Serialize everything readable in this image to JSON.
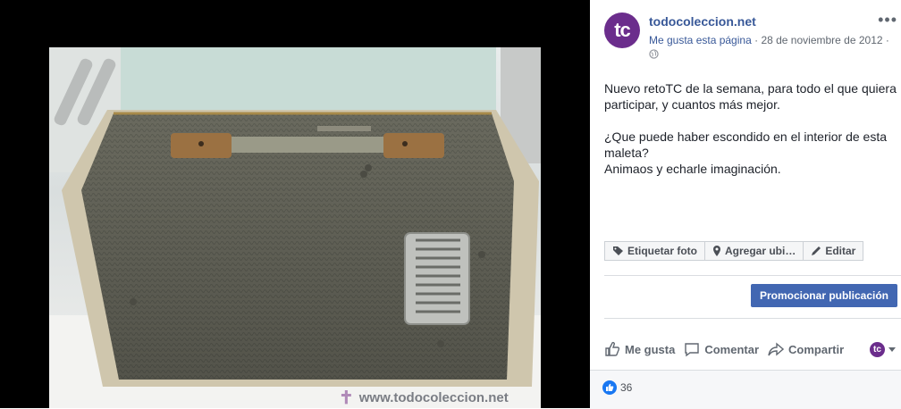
{
  "post": {
    "page_name": "todocoleccion.net",
    "avatar_text": "tc",
    "like_page_link": "Me gusta esta página",
    "separator": "·",
    "date": "28 de noviembre de 2012",
    "more_label": "•••",
    "text_lines": [
      "Nuevo retoTC de la semana, para todo el que quiera participar, y cuantos más mejor.",
      "¿Que puede haber escondido en el interior de esta maleta?",
      "Animaos y echarle imaginación."
    ]
  },
  "photo": {
    "watermark": "www.todocoleccion.net"
  },
  "photo_actions": {
    "tag": "Etiquetar foto",
    "location": "Agregar ubi…",
    "edit": "Editar"
  },
  "promote_label": "Promocionar publicación",
  "actions": {
    "like": "Me gusta",
    "comment": "Comentar",
    "share": "Compartir"
  },
  "reactions": {
    "count": "36"
  },
  "colors": {
    "brand": "#6b2d8c",
    "fb_link": "#385898",
    "fb_button": "#4267b2"
  }
}
